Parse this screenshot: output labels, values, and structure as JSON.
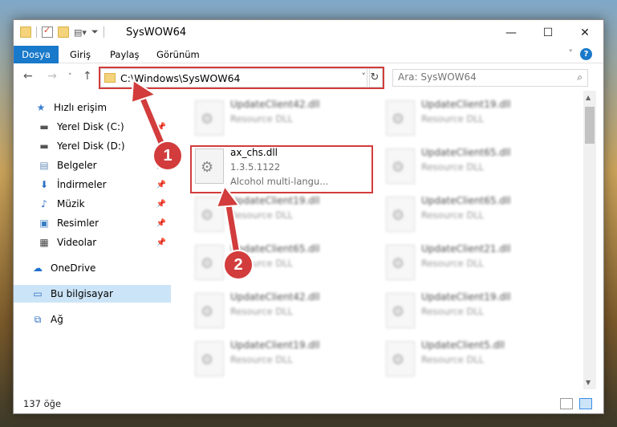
{
  "window": {
    "title": "SysWOW64",
    "controls": {
      "minimize": "—",
      "maximize": "☐",
      "close": "✕"
    }
  },
  "ribbon": {
    "tabs": [
      "Dosya",
      "Giriş",
      "Paylaş",
      "Görünüm"
    ],
    "help": "?"
  },
  "address": {
    "path": "C:\\Windows\\SysWOW64",
    "search_placeholder": "Ara: SysWOW64"
  },
  "nav": {
    "items": [
      {
        "label": "Hızlı erişim",
        "icon": "star-icon"
      },
      {
        "label": "Yerel Disk (C:)",
        "icon": "drive-icon"
      },
      {
        "label": "Yerel Disk (D:)",
        "icon": "drive-icon"
      },
      {
        "label": "Belgeler",
        "icon": "document-icon"
      },
      {
        "label": "İndirmeler",
        "icon": "download-icon"
      },
      {
        "label": "Müzik",
        "icon": "music-icon"
      },
      {
        "label": "Resimler",
        "icon": "picture-icon"
      },
      {
        "label": "Videolar",
        "icon": "video-icon"
      },
      {
        "label": "OneDrive",
        "icon": "cloud-icon"
      },
      {
        "label": "Bu bilgisayar",
        "icon": "computer-icon"
      },
      {
        "label": "Ağ",
        "icon": "network-icon"
      }
    ]
  },
  "files": {
    "highlighted": {
      "name": "ax_chs.dll",
      "version": "1.3.5.1122",
      "description": "Alcohol multi-langu..."
    },
    "left_column": [
      {
        "name": "UpdateClient42.dll",
        "type": "Resource DLL"
      },
      {
        "name": "UpdateClient19.dll",
        "type": "Resource DLL"
      },
      {
        "name": "UpdateClient65.dll",
        "type": "Resource DLL"
      },
      {
        "name": "UpdateClient42.dll",
        "type": "Resource DLL"
      },
      {
        "name": "UpdateClient19.dll",
        "type": "Resource DLL"
      }
    ],
    "right_column": [
      {
        "name": "UpdateClient19.dll",
        "type": "Resource DLL"
      },
      {
        "name": "UpdateClient65.dll",
        "type": "Resource DLL"
      },
      {
        "name": "UpdateClient65.dll",
        "type": "Resource DLL"
      },
      {
        "name": "UpdateClient21.dll",
        "type": "Resource DLL"
      },
      {
        "name": "UpdateClient19.dll",
        "type": "Resource DLL"
      },
      {
        "name": "UpdateClient5.dll",
        "type": "Resource DLL"
      }
    ]
  },
  "status": {
    "count": "137 öğe"
  },
  "callouts": [
    "1",
    "2"
  ],
  "colors": {
    "accent": "#1979ca",
    "highlight": "#d23c3c",
    "selection": "#cce4f7"
  }
}
